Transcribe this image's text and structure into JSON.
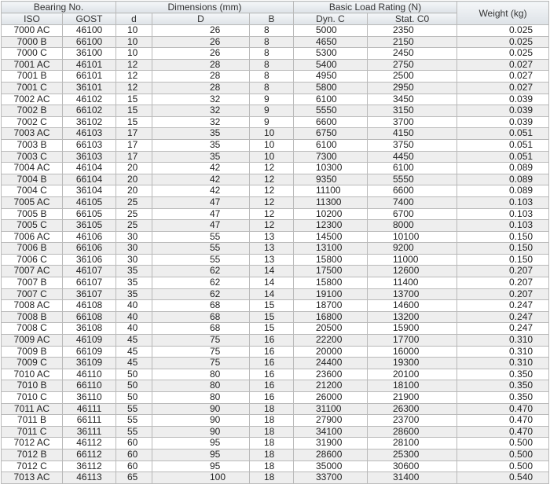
{
  "header": {
    "bearing_no": "Bearing No.",
    "dimensions": "Dimensions (mm)",
    "load_rating": "Basic Load Rating (N)",
    "weight": "Weight (kg)",
    "iso": "ISO",
    "gost": "GOST",
    "d": "d",
    "D": "D",
    "B": "B",
    "dyn": "Dyn. C",
    "stat": "Stat. C0"
  },
  "rows": [
    [
      "7000 AC",
      "46100",
      "10",
      "26",
      "8",
      "5000",
      "2350",
      "0.025"
    ],
    [
      "7000 B",
      "66100",
      "10",
      "26",
      "8",
      "4650",
      "2150",
      "0.025"
    ],
    [
      "7000 C",
      "36100",
      "10",
      "26",
      "8",
      "5300",
      "2450",
      "0.025"
    ],
    [
      "7001 AC",
      "46101",
      "12",
      "28",
      "8",
      "5400",
      "2750",
      "0.027"
    ],
    [
      "7001 B",
      "66101",
      "12",
      "28",
      "8",
      "4950",
      "2500",
      "0.027"
    ],
    [
      "7001 C",
      "36101",
      "12",
      "28",
      "8",
      "5800",
      "2950",
      "0.027"
    ],
    [
      "7002 AC",
      "46102",
      "15",
      "32",
      "9",
      "6100",
      "3450",
      "0.039"
    ],
    [
      "7002 B",
      "66102",
      "15",
      "32",
      "9",
      "5550",
      "3150",
      "0.039"
    ],
    [
      "7002 C",
      "36102",
      "15",
      "32",
      "9",
      "6600",
      "3700",
      "0.039"
    ],
    [
      "7003 AC",
      "46103",
      "17",
      "35",
      "10",
      "6750",
      "4150",
      "0.051"
    ],
    [
      "7003 B",
      "66103",
      "17",
      "35",
      "10",
      "6100",
      "3750",
      "0.051"
    ],
    [
      "7003 C",
      "36103",
      "17",
      "35",
      "10",
      "7300",
      "4450",
      "0.051"
    ],
    [
      "7004 AC",
      "46104",
      "20",
      "42",
      "12",
      "10300",
      "6100",
      "0.089"
    ],
    [
      "7004 B",
      "66104",
      "20",
      "42",
      "12",
      "9350",
      "5550",
      "0.089"
    ],
    [
      "7004 C",
      "36104",
      "20",
      "42",
      "12",
      "11100",
      "6600",
      "0.089"
    ],
    [
      "7005 AC",
      "46105",
      "25",
      "47",
      "12",
      "11300",
      "7400",
      "0.103"
    ],
    [
      "7005 B",
      "66105",
      "25",
      "47",
      "12",
      "10200",
      "6700",
      "0.103"
    ],
    [
      "7005 C",
      "36105",
      "25",
      "47",
      "12",
      "12300",
      "8000",
      "0.103"
    ],
    [
      "7006 AC",
      "46106",
      "30",
      "55",
      "13",
      "14500",
      "10100",
      "0.150"
    ],
    [
      "7006 B",
      "66106",
      "30",
      "55",
      "13",
      "13100",
      "9200",
      "0.150"
    ],
    [
      "7006 C",
      "36106",
      "30",
      "55",
      "13",
      "15800",
      "11000",
      "0.150"
    ],
    [
      "7007 AC",
      "46107",
      "35",
      "62",
      "14",
      "17500",
      "12600",
      "0.207"
    ],
    [
      "7007 B",
      "66107",
      "35",
      "62",
      "14",
      "15800",
      "11400",
      "0.207"
    ],
    [
      "7007 C",
      "36107",
      "35",
      "62",
      "14",
      "19100",
      "13700",
      "0.207"
    ],
    [
      "7008 AC",
      "46108",
      "40",
      "68",
      "15",
      "18700",
      "14600",
      "0.247"
    ],
    [
      "7008 B",
      "66108",
      "40",
      "68",
      "15",
      "16800",
      "13200",
      "0.247"
    ],
    [
      "7008 C",
      "36108",
      "40",
      "68",
      "15",
      "20500",
      "15900",
      "0.247"
    ],
    [
      "7009 AC",
      "46109",
      "45",
      "75",
      "16",
      "22200",
      "17700",
      "0.310"
    ],
    [
      "7009 B",
      "66109",
      "45",
      "75",
      "16",
      "20000",
      "16000",
      "0.310"
    ],
    [
      "7009 C",
      "36109",
      "45",
      "75",
      "16",
      "24400",
      "19300",
      "0.310"
    ],
    [
      "7010 AC",
      "46110",
      "50",
      "80",
      "16",
      "23600",
      "20100",
      "0.350"
    ],
    [
      "7010 B",
      "66110",
      "50",
      "80",
      "16",
      "21200",
      "18100",
      "0.350"
    ],
    [
      "7010 C",
      "36110",
      "50",
      "80",
      "16",
      "26000",
      "21900",
      "0.350"
    ],
    [
      "7011 AC",
      "46111",
      "55",
      "90",
      "18",
      "31100",
      "26300",
      "0.470"
    ],
    [
      "7011 B",
      "66111",
      "55",
      "90",
      "18",
      "27900",
      "23700",
      "0.470"
    ],
    [
      "7011 C",
      "36111",
      "55",
      "90",
      "18",
      "34100",
      "28600",
      "0.470"
    ],
    [
      "7012 AC",
      "46112",
      "60",
      "95",
      "18",
      "31900",
      "28100",
      "0.500"
    ],
    [
      "7012 B",
      "66112",
      "60",
      "95",
      "18",
      "28600",
      "25300",
      "0.500"
    ],
    [
      "7012 C",
      "36112",
      "60",
      "95",
      "18",
      "35000",
      "30600",
      "0.500"
    ],
    [
      "7013 AC",
      "46113",
      "65",
      "100",
      "18",
      "33700",
      "31400",
      "0.540"
    ]
  ]
}
